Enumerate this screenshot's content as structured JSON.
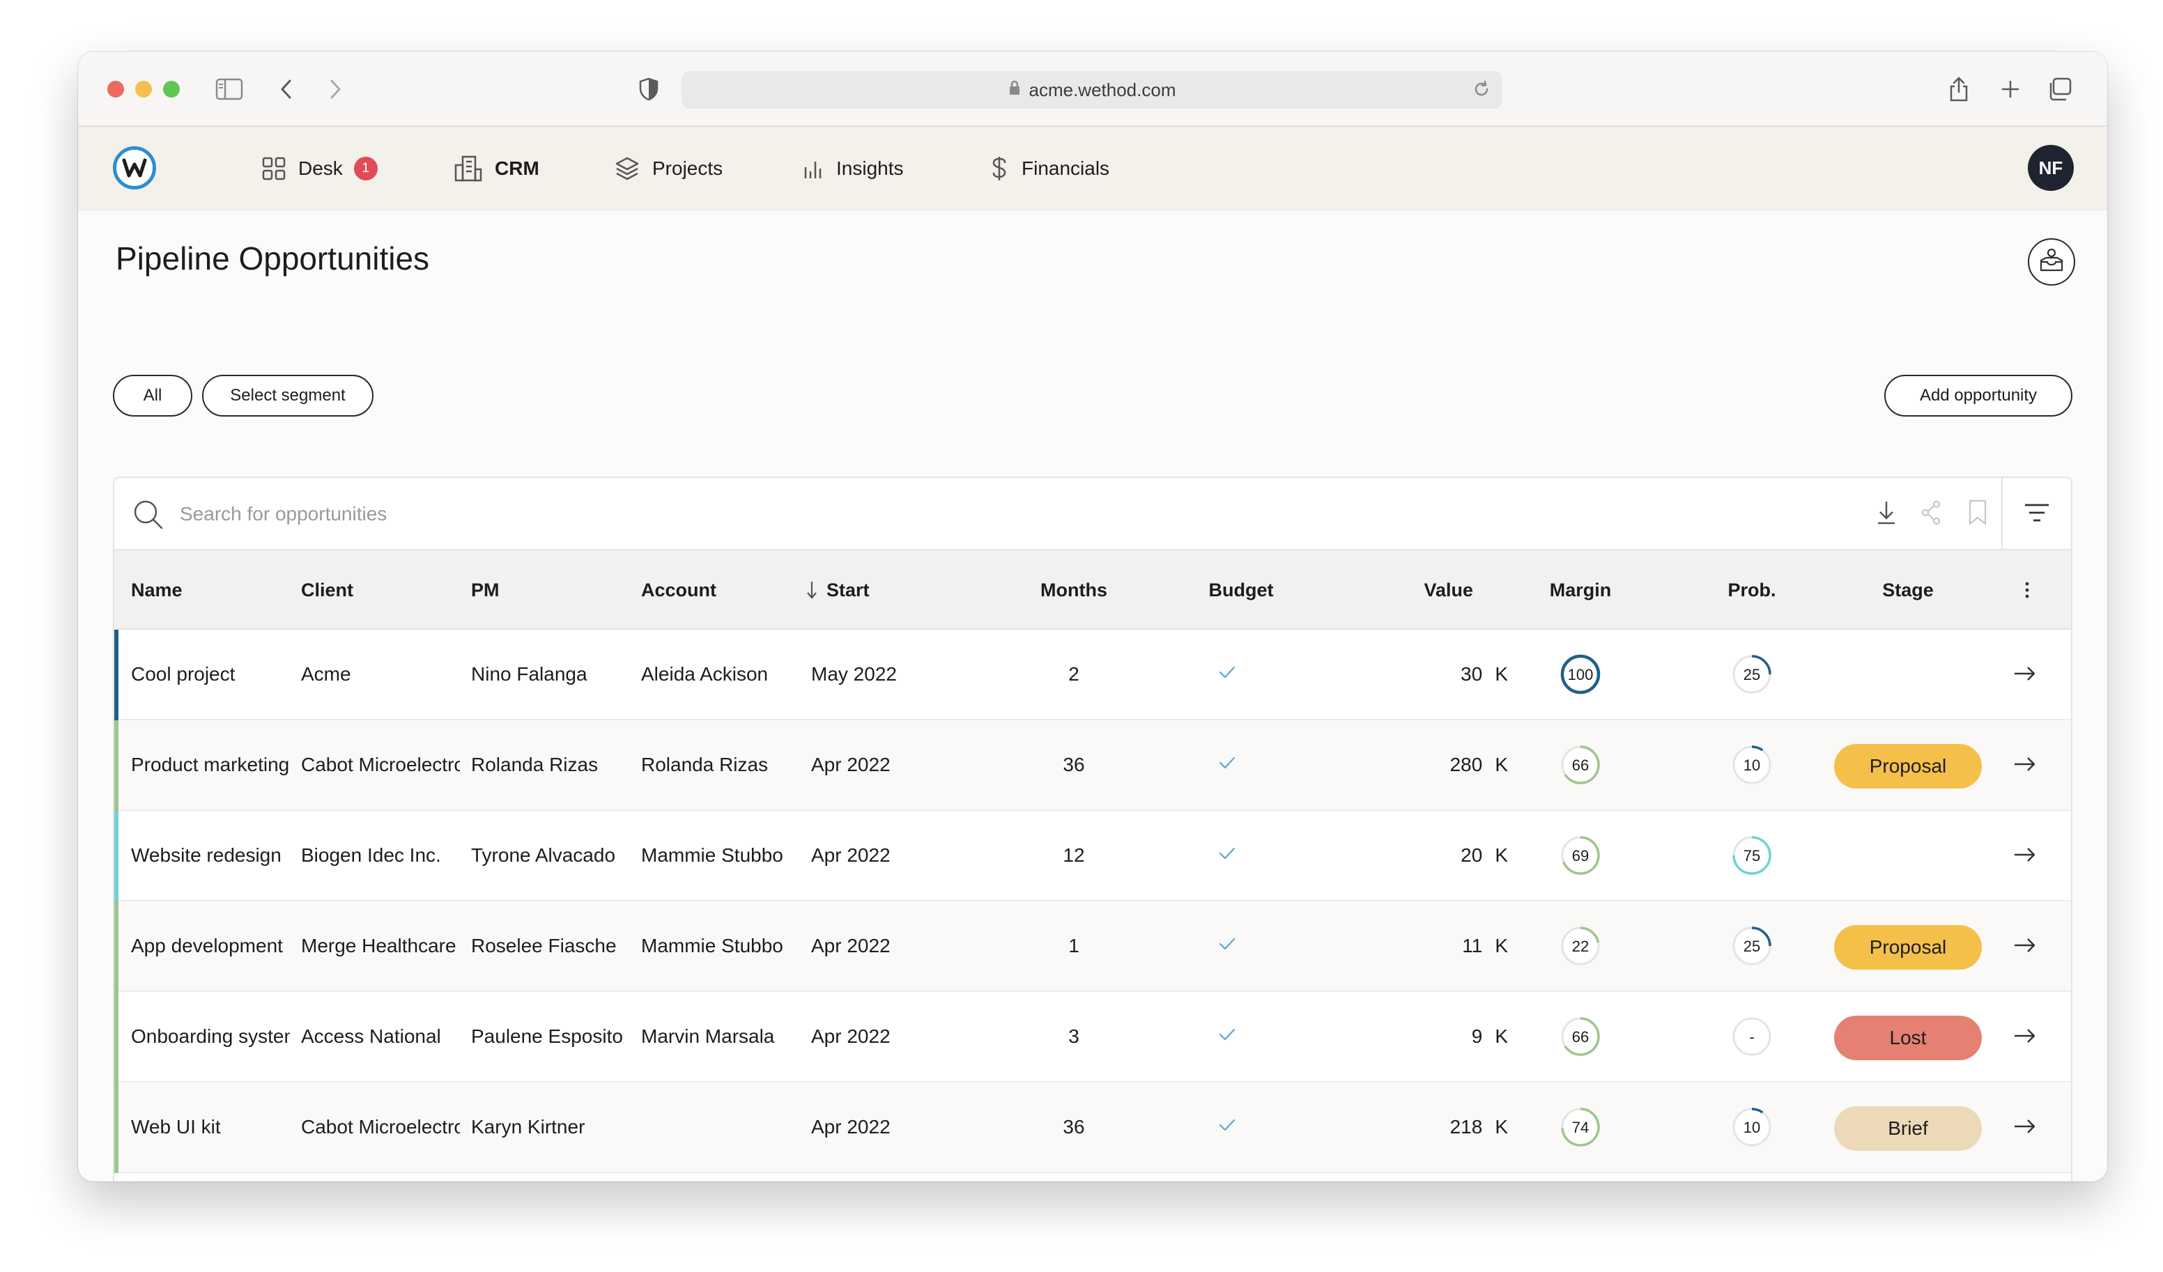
{
  "browser": {
    "url": "acme.wethod.com"
  },
  "nav": {
    "items": [
      {
        "label": "Desk",
        "icon": "grid-icon",
        "badge": "1"
      },
      {
        "label": "CRM",
        "icon": "building-icon",
        "active": true
      },
      {
        "label": "Projects",
        "icon": "layers-icon"
      },
      {
        "label": "Insights",
        "icon": "bar-chart-icon"
      },
      {
        "label": "Financials",
        "icon": "dollar-icon"
      }
    ],
    "user_initials": "NF"
  },
  "page": {
    "title": "Pipeline Opportunities",
    "segment_all": "All",
    "segment_select": "Select segment",
    "add_button": "Add opportunity"
  },
  "search": {
    "placeholder": "Search for opportunities"
  },
  "table": {
    "columns": [
      "Name",
      "Client",
      "PM",
      "Account",
      "Start",
      "Months",
      "Budget",
      "Value",
      "Margin",
      "Prob.",
      "Stage"
    ],
    "sort_column": "Start",
    "rows": [
      {
        "name": "Cool project",
        "client": "Acme",
        "pm": "Nino Falanga",
        "account": "Aleida Ackison",
        "start": "May 2022",
        "months": "2",
        "budget": true,
        "value": "30",
        "unit": "K",
        "margin": "100",
        "prob": "25",
        "stage": "",
        "bar_color": "#1f5f8b"
      },
      {
        "name": "Product marketing",
        "client": "Cabot Microelectronics",
        "pm": "Rolanda Rizas",
        "account": "Rolanda Rizas",
        "start": "Apr 2022",
        "months": "36",
        "budget": true,
        "value": "280",
        "unit": "K",
        "margin": "66",
        "prob": "10",
        "stage": "Proposal",
        "bar_color": "#9ec58e"
      },
      {
        "name": "Website redesign",
        "client": "Biogen Idec Inc.",
        "pm": "Tyrone Alvacado",
        "account": "Mammie Stubbo",
        "start": "Apr 2022",
        "months": "12",
        "budget": true,
        "value": "20",
        "unit": "K",
        "margin": "69",
        "prob": "75",
        "stage": "",
        "bar_color": "#6fd3d3"
      },
      {
        "name": "App development",
        "client": "Merge Healthcare",
        "pm": "Roselee Fiasche",
        "account": "Mammie Stubbo",
        "start": "Apr 2022",
        "months": "1",
        "budget": true,
        "value": "11",
        "unit": "K",
        "margin": "22",
        "prob": "25",
        "stage": "Proposal",
        "bar_color": "#9ec58e"
      },
      {
        "name": "Onboarding system",
        "client": "Access National",
        "pm": "Paulene Esposito",
        "account": "Marvin Marsala",
        "start": "Apr 2022",
        "months": "3",
        "budget": true,
        "value": "9",
        "unit": "K",
        "margin": "66",
        "prob": "-",
        "stage": "Lost",
        "bar_color": "#9ec58e"
      },
      {
        "name": "Web UI kit",
        "client": "Cabot Microelectronics",
        "pm": "Karyn Kirtner",
        "account": "",
        "start": "Apr 2022",
        "months": "36",
        "budget": true,
        "value": "218",
        "unit": "K",
        "margin": "74",
        "prob": "10",
        "stage": "Brief",
        "bar_color": "#9ec58e"
      }
    ]
  },
  "colors": {
    "proposal": "#f5c04a",
    "lost": "#e58073",
    "brief": "#ecd9b8",
    "check": "#5aa7d8",
    "margin_ring": "#9ec58e",
    "margin_full": "#1f5f8b",
    "prob_ring": "#6fd3d3"
  }
}
